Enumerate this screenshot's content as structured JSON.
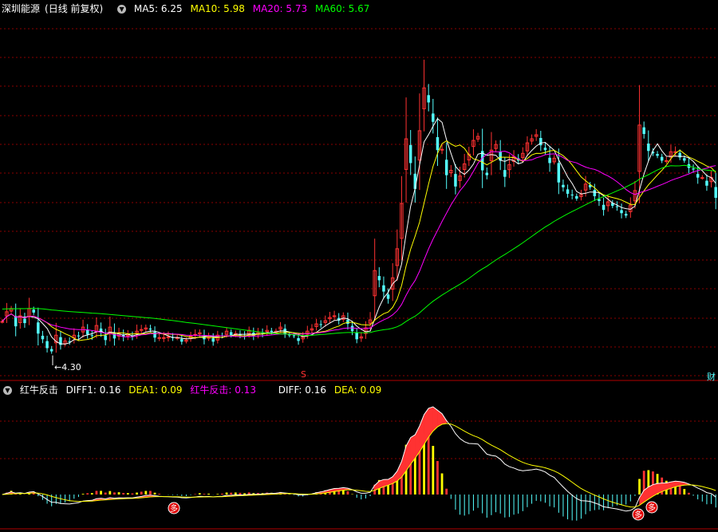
{
  "header": {
    "stock": "深圳能源",
    "mode": "(日线 前复权)",
    "dropdown_icon": "chevron-down-icon",
    "ma5": "MA5: 6.25",
    "ma10": "MA10: 5.98",
    "ma20": "MA20: 5.73",
    "ma60": "MA60: 5.67"
  },
  "lower": {
    "name": "红牛反击",
    "diff1": "DIFF1: 0.16",
    "dea1": "DEA1: 0.09",
    "hn": "红牛反击: 0.13",
    "diff": "DIFF: 0.16",
    "dea": "DEA: 0.09"
  },
  "labels": {
    "low_price": "4.30",
    "event_marker": "S",
    "right_edge": "财",
    "signal": "多"
  },
  "colors": {
    "up": "#ff3232",
    "down": "#54ffff",
    "ma5": "#ffffff",
    "ma10": "#ffff00",
    "ma20": "#ff00ff",
    "ma60": "#00ff00",
    "grid": "#8b0000"
  },
  "chart_data": {
    "type": "candlestick",
    "price_range": [
      4.0,
      8.5
    ],
    "low_marker": 4.3,
    "close": [
      4.72,
      4.84,
      4.88,
      4.66,
      4.79,
      4.7,
      4.88,
      4.83,
      4.57,
      4.5,
      4.39,
      4.35,
      4.55,
      4.43,
      4.48,
      4.47,
      4.55,
      4.54,
      4.65,
      4.56,
      4.54,
      4.67,
      4.59,
      4.49,
      4.65,
      4.51,
      4.58,
      4.53,
      4.55,
      4.53,
      4.6,
      4.62,
      4.64,
      4.62,
      4.52,
      4.52,
      4.52,
      4.53,
      4.52,
      4.52,
      4.47,
      4.49,
      4.54,
      4.56,
      4.58,
      4.5,
      4.54,
      4.47,
      4.55,
      4.54,
      4.6,
      4.55,
      4.57,
      4.55,
      4.54,
      4.61,
      4.54,
      4.58,
      4.57,
      4.61,
      4.59,
      4.6,
      4.65,
      4.56,
      4.55,
      4.54,
      4.48,
      4.53,
      4.6,
      4.63,
      4.69,
      4.68,
      4.73,
      4.77,
      4.79,
      4.73,
      4.79,
      4.69,
      4.6,
      4.5,
      4.53,
      4.64,
      4.74,
      5.35,
      5.23,
      5.09,
      5.0,
      5.26,
      5.62,
      6.18,
      6.98,
      6.68,
      6.36,
      7.08,
      7.61,
      7.43,
      7.19,
      6.84,
      6.85,
      6.53,
      6.59,
      6.39,
      6.52,
      6.67,
      6.79,
      6.96,
      7.01,
      6.59,
      6.53,
      6.84,
      6.91,
      6.71,
      6.51,
      6.66,
      6.76,
      6.71,
      6.8,
      6.93,
      6.98,
      7.03,
      6.9,
      6.84,
      6.68,
      6.74,
      6.44,
      6.38,
      6.3,
      6.28,
      6.24,
      6.29,
      6.42,
      6.38,
      6.27,
      6.21,
      6.1,
      6.2,
      6.15,
      6.14,
      6.06,
      6.03,
      6.16,
      6.34,
      7.15,
      7.04,
      6.83,
      6.8,
      6.77,
      6.71,
      6.71,
      6.82,
      6.82,
      6.75,
      6.71,
      6.62,
      6.6,
      6.5,
      6.5,
      6.4,
      6.5,
      6.25
    ]
  }
}
